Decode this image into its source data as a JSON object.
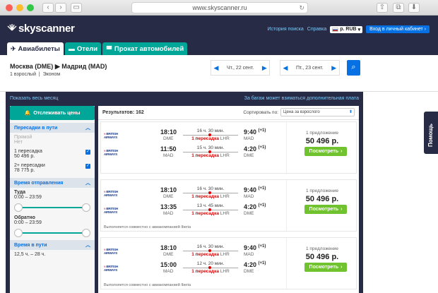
{
  "browser": {
    "url": "www.skyscanner.ru",
    "colors": {
      "close": "#fc5f57",
      "min": "#fdbc2e",
      "max": "#33c748"
    }
  },
  "header": {
    "logo": "skyscanner",
    "history": "История поиска",
    "help": "Справка",
    "currency": "р. RUB",
    "login": "Вход в личный кабинет",
    "tabs": [
      "Авиабилеты",
      "Отели",
      "Прокат автомобилей"
    ]
  },
  "summary": {
    "from": "Москва (DME)",
    "to": "Мадрид (MAD)",
    "pax": "1 взрослый",
    "cabin": "Эконом",
    "depart": "Чт., 22 сент.",
    "return": "Пт., 23 сент."
  },
  "links": {
    "show_month": "Показать весь месяц",
    "bag_note": "За багаж может взиматься дополнительная плата"
  },
  "sidebar": {
    "track": "Отслеживать цены",
    "stops_title": "Пересадки в пути",
    "direct_label": "Прямой",
    "direct_value": "Нет",
    "one_stop_label": "1 пересадка",
    "one_stop_price": "50 496 р.",
    "two_stop_label": "2+ пересадки",
    "two_stop_price": "78 775 р.",
    "dep_title": "Время отправления",
    "out_label": "Туда",
    "out_range": "0:00 – 23:59",
    "back_label": "Обратно",
    "back_range": "0:00 – 23:59",
    "travel_title": "Время в пути",
    "travel_range": "12,5 ч. – 28 ч."
  },
  "results": {
    "count_label": "Результатов: 162",
    "sort_label": "Сортировать по:",
    "sort_value": "Цена за взрослого",
    "airline": "BRITISH AIRWAYS",
    "offers": "1 предложение",
    "view": "Посмотреть",
    "joint": "Выполняется совместно с авиакомпанией Iberia",
    "cards": [
      {
        "legs": [
          {
            "dep": "18:10",
            "from": "DME",
            "duration": "16 ч. 30 мин.",
            "stops": "1 пересадка",
            "via": "LHR",
            "arr": "9:40",
            "plus": "(+1)",
            "to": "MAD"
          },
          {
            "dep": "11:50",
            "from": "MAD",
            "duration": "15 ч. 30 мин.",
            "stops": "1 пересадка",
            "via": "LHR",
            "arr": "4:20",
            "plus": "(+1)",
            "to": "DME"
          }
        ],
        "price": "50 496 р.",
        "joint": false
      },
      {
        "legs": [
          {
            "dep": "18:10",
            "from": "DME",
            "duration": "16 ч. 30 мин.",
            "stops": "1 пересадка",
            "via": "LHR",
            "arr": "9:40",
            "plus": "(+1)",
            "to": "MAD"
          },
          {
            "dep": "13:35",
            "from": "MAD",
            "duration": "13 ч. 45 мин.",
            "stops": "1 пересадка",
            "via": "LHR",
            "arr": "4:20",
            "plus": "(+1)",
            "to": "DME"
          }
        ],
        "price": "50 496 р.",
        "joint": true
      },
      {
        "legs": [
          {
            "dep": "18:10",
            "from": "DME",
            "duration": "16 ч. 30 мин.",
            "stops": "1 пересадка",
            "via": "LHR",
            "arr": "9:40",
            "plus": "(+1)",
            "to": "MAD"
          },
          {
            "dep": "15:00",
            "from": "MAD",
            "duration": "12 ч. 20 мин.",
            "stops": "1 пересадка",
            "via": "LHR",
            "arr": "4:20",
            "plus": "(+1)",
            "to": "DME"
          }
        ],
        "price": "50 496 р.",
        "joint": true
      }
    ]
  },
  "help_tab": "Помощь"
}
